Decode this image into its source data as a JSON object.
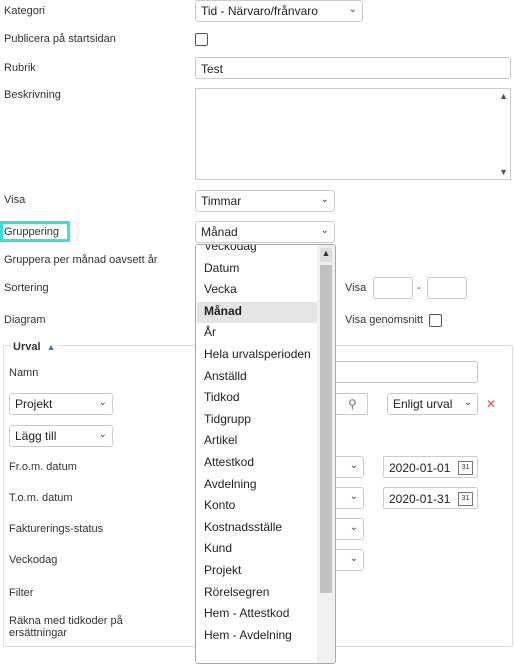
{
  "form": {
    "kategori_label": "Kategori",
    "kategori_value": "Tid - Närvaro/frånvaro",
    "publicera_label": "Publicera på startsidan",
    "rubrik_label": "Rubrik",
    "rubrik_value": "Test",
    "beskrivning_label": "Beskrivning",
    "visa_label": "Visa",
    "visa_value": "Timmar",
    "gruppering_label": "Gruppering",
    "gruppering_value": "Månad",
    "gruppera_manad_label": "Gruppera per månad oavsett år",
    "sortering_label": "Sortering",
    "sort_visa_label": "Visa",
    "sort_dash": "-",
    "diagram_label": "Diagram",
    "visa_genomsnitt_label": "Visa genomsnitt"
  },
  "urval": {
    "title": "Urval",
    "namn_label": "Namn",
    "projekt_select": "Projekt",
    "enligt_urval": "Enligt urval",
    "lagg_till": "Lägg till",
    "from_label": "Fr.o.m. datum",
    "from_value": "2020-01-01",
    "tom_label": "T.o.m. datum",
    "tom_value": "2020-01-31",
    "fakt_label": "Fakturerings-status",
    "veckodag_label": "Veckodag",
    "filter_label": "Filter",
    "rakna_label_1": "Räkna med tidkoder på",
    "rakna_label_2": "ersättningar",
    "calendar_day": "31"
  },
  "dropdown": {
    "items": [
      "Veckodag",
      "Datum",
      "Vecka",
      "Månad",
      "År",
      "Hela urvalsperioden",
      "Anställd",
      "Tidkod",
      "Tidgrupp",
      "Artikel",
      "Attestkod",
      "Avdelning",
      "Konto",
      "Kostnadsställe",
      "Kund",
      "Projekt",
      "Rörelsegren",
      "Hem - Attestkod",
      "Hem - Avdelning"
    ],
    "selected": "Månad"
  },
  "colors": {
    "highlight_border": "#2ee6d6",
    "remove_icon": "#e05050",
    "chevron": "#3a78c4"
  }
}
